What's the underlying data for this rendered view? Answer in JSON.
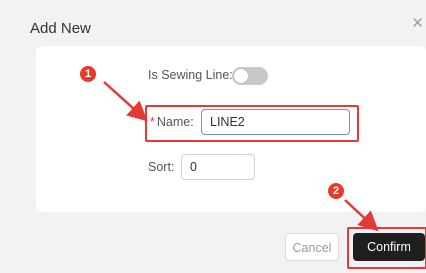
{
  "dialog": {
    "title": "Add New",
    "close_icon": "close-icon"
  },
  "form": {
    "sewing_line_label": "Is Sewing Line:",
    "sewing_line_enabled": false,
    "name_label": "Name:",
    "name_required_mark": "*",
    "name_value": "LINE2",
    "sort_label": "Sort:",
    "sort_value": "0"
  },
  "buttons": {
    "cancel_label": "Cancel",
    "confirm_label": "Confirm"
  },
  "annotations": {
    "step1": "1",
    "step2": "2",
    "color": "#e53935"
  }
}
